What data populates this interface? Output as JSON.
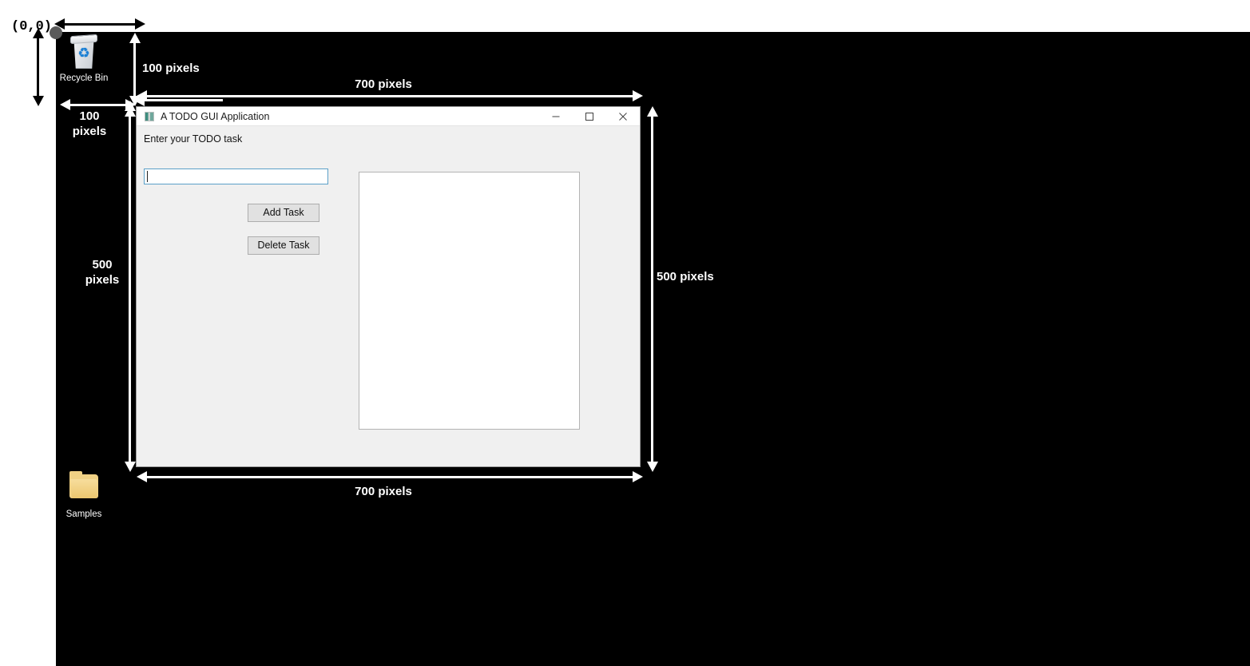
{
  "desktop": {
    "background_color": "#000000",
    "origin_label": "(0,0)",
    "icons": [
      {
        "name": "recycle-bin",
        "label": "Recycle Bin",
        "icon": "recycle-bin-icon"
      },
      {
        "name": "samples-folder",
        "label": "Samples",
        "icon": "folder-icon"
      }
    ]
  },
  "annotations": {
    "top_offset_x": "100 pixels",
    "left_offset_y": "100\npixels",
    "window_offset_x": "100 pixels",
    "window_offset_y": "100\npixels",
    "width_top": "700 pixels",
    "width_bottom": "700 pixels",
    "height_left": "500\npixels",
    "height_right": "500 pixels"
  },
  "window": {
    "title": "A TODO GUI Application",
    "icon": "app-icon",
    "controls": {
      "minimize": "minimize-icon",
      "maximize": "maximize-icon",
      "close": "close-icon"
    },
    "form": {
      "input_label": "Enter your TODO task",
      "input_value": "",
      "input_placeholder": ""
    },
    "buttons": {
      "add": "Add Task",
      "delete": "Delete Task"
    },
    "task_list": {
      "items": []
    },
    "colors": {
      "client_bg": "#f0f0f0",
      "titlebar_bg": "#ffffff",
      "input_border": "#5ba0c8",
      "button_bg": "#e1e1e1"
    }
  }
}
